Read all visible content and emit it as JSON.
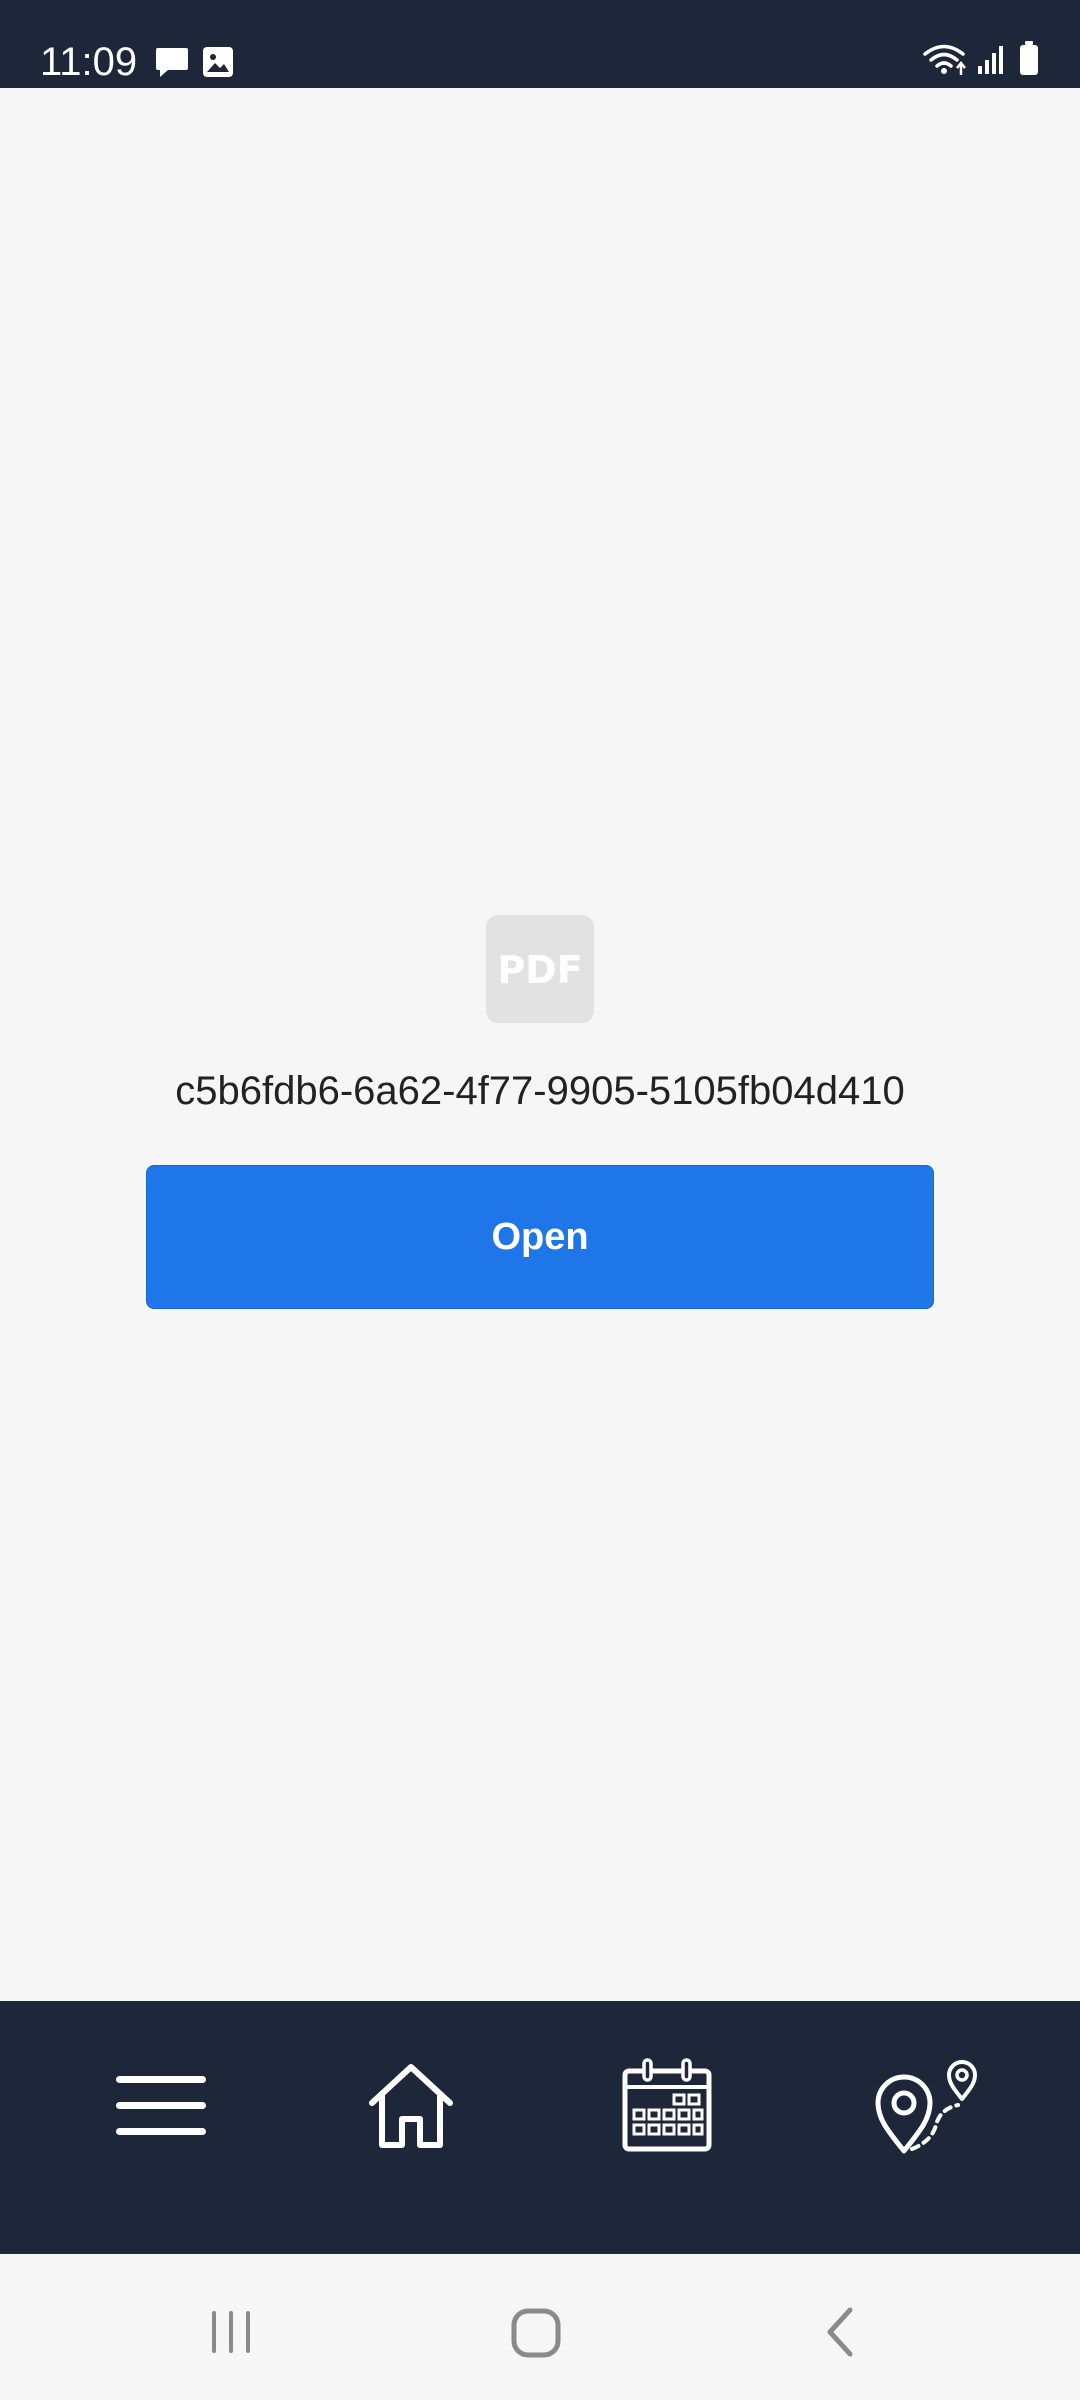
{
  "status_bar": {
    "time": "11:09",
    "left_icons": [
      "message-icon",
      "image-icon"
    ],
    "right_icons": [
      "wifi-icon",
      "signal-icon",
      "battery-icon"
    ]
  },
  "document": {
    "icon": "pdf-file-icon",
    "icon_label": "PDF",
    "file_name": "c5b6fdb6-6a62-4f77-9905-5105fb04d410",
    "open_label": "Open"
  },
  "bottom_nav": {
    "items": [
      "menu-icon",
      "home-icon",
      "calendar-icon",
      "route-map-icon"
    ]
  },
  "system_nav": {
    "buttons": [
      "recents-icon",
      "home-button-icon",
      "back-icon"
    ]
  },
  "colors": {
    "bar_background": "#1e2639",
    "page_background": "#f6f6f6",
    "accent": "#1e76e8",
    "text": "#222222"
  }
}
